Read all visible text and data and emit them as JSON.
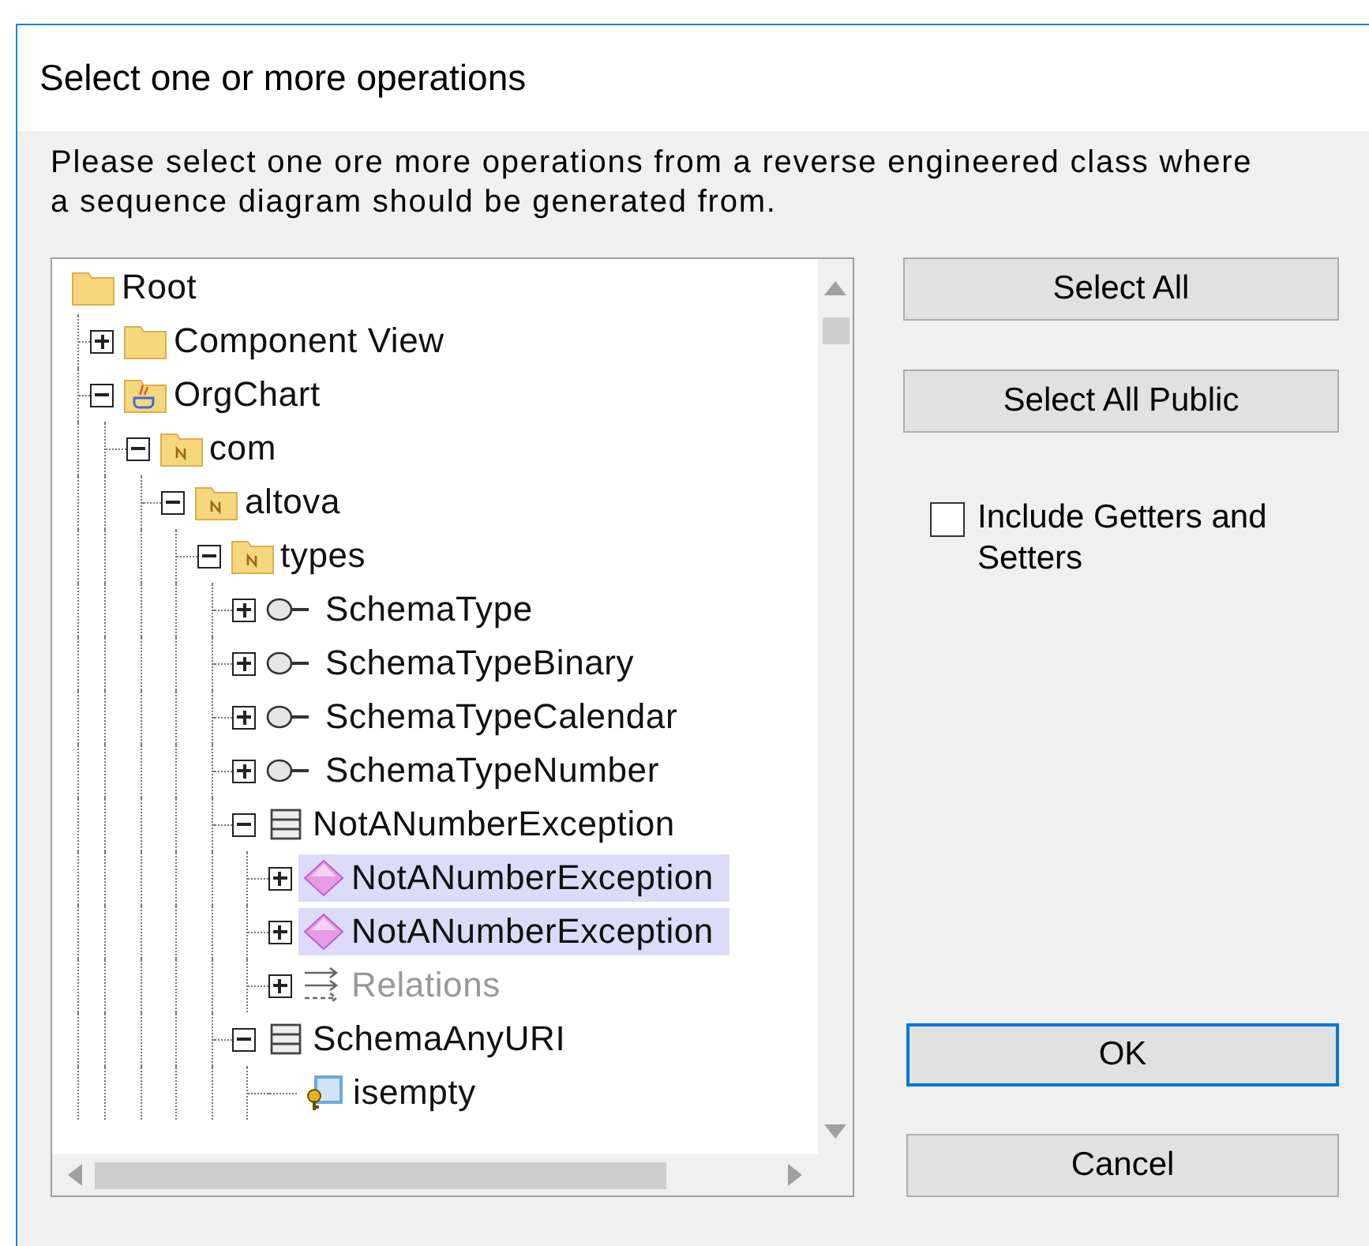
{
  "window": {
    "title": "Select one or more operations"
  },
  "instructions": "Please select one ore more operations from a reverse engineered class where a sequence diagram should be generated from.",
  "tree": {
    "items": [
      {
        "label": "Root",
        "kind": "folder",
        "selected": false,
        "disabled": false,
        "children": [
          {
            "label": "Component View",
            "kind": "folder",
            "expanded": false,
            "selected": false,
            "disabled": false
          },
          {
            "label": "OrgChart",
            "kind": "java-folder",
            "expanded": true,
            "selected": false,
            "disabled": false,
            "children": [
              {
                "label": "com",
                "kind": "namespace",
                "expanded": true,
                "selected": false,
                "disabled": false,
                "children": [
                  {
                    "label": "altova",
                    "kind": "namespace",
                    "expanded": true,
                    "selected": false,
                    "disabled": false,
                    "children": [
                      {
                        "label": "types",
                        "kind": "namespace",
                        "expanded": true,
                        "selected": false,
                        "disabled": false,
                        "children": [
                          {
                            "label": "SchemaType",
                            "kind": "interface",
                            "expanded": false,
                            "selected": false,
                            "disabled": false
                          },
                          {
                            "label": "SchemaTypeBinary",
                            "kind": "interface",
                            "expanded": false,
                            "selected": false,
                            "disabled": false
                          },
                          {
                            "label": "SchemaTypeCalendar",
                            "kind": "interface",
                            "expanded": false,
                            "selected": false,
                            "disabled": false
                          },
                          {
                            "label": "SchemaTypeNumber",
                            "kind": "interface",
                            "expanded": false,
                            "selected": false,
                            "disabled": false
                          },
                          {
                            "label": "NotANumberException",
                            "kind": "class",
                            "expanded": true,
                            "selected": false,
                            "disabled": false,
                            "children": [
                              {
                                "label": "NotANumberException",
                                "kind": "object",
                                "expanded": false,
                                "selected": true,
                                "disabled": false
                              },
                              {
                                "label": "NotANumberException",
                                "kind": "object",
                                "expanded": false,
                                "selected": true,
                                "disabled": false
                              },
                              {
                                "label": "Relations",
                                "kind": "relations",
                                "expanded": false,
                                "selected": false,
                                "disabled": true
                              }
                            ]
                          },
                          {
                            "label": "SchemaAnyURI",
                            "kind": "class",
                            "expanded": true,
                            "selected": false,
                            "disabled": false,
                            "children": [
                              {
                                "label": "isempty",
                                "kind": "operation",
                                "selected": false,
                                "disabled": false
                              }
                            ]
                          }
                        ]
                      }
                    ]
                  }
                ]
              }
            ]
          }
        ]
      }
    ]
  },
  "buttons": [
    {
      "label": "Select All",
      "default": false
    },
    {
      "label": "Select All Public",
      "default": false
    }
  ],
  "checkbox": {
    "label": "Include Getters and Setters",
    "checked": false
  },
  "dialog_buttons": [
    {
      "label": "OK",
      "default": true
    },
    {
      "label": "Cancel",
      "default": false
    }
  ]
}
